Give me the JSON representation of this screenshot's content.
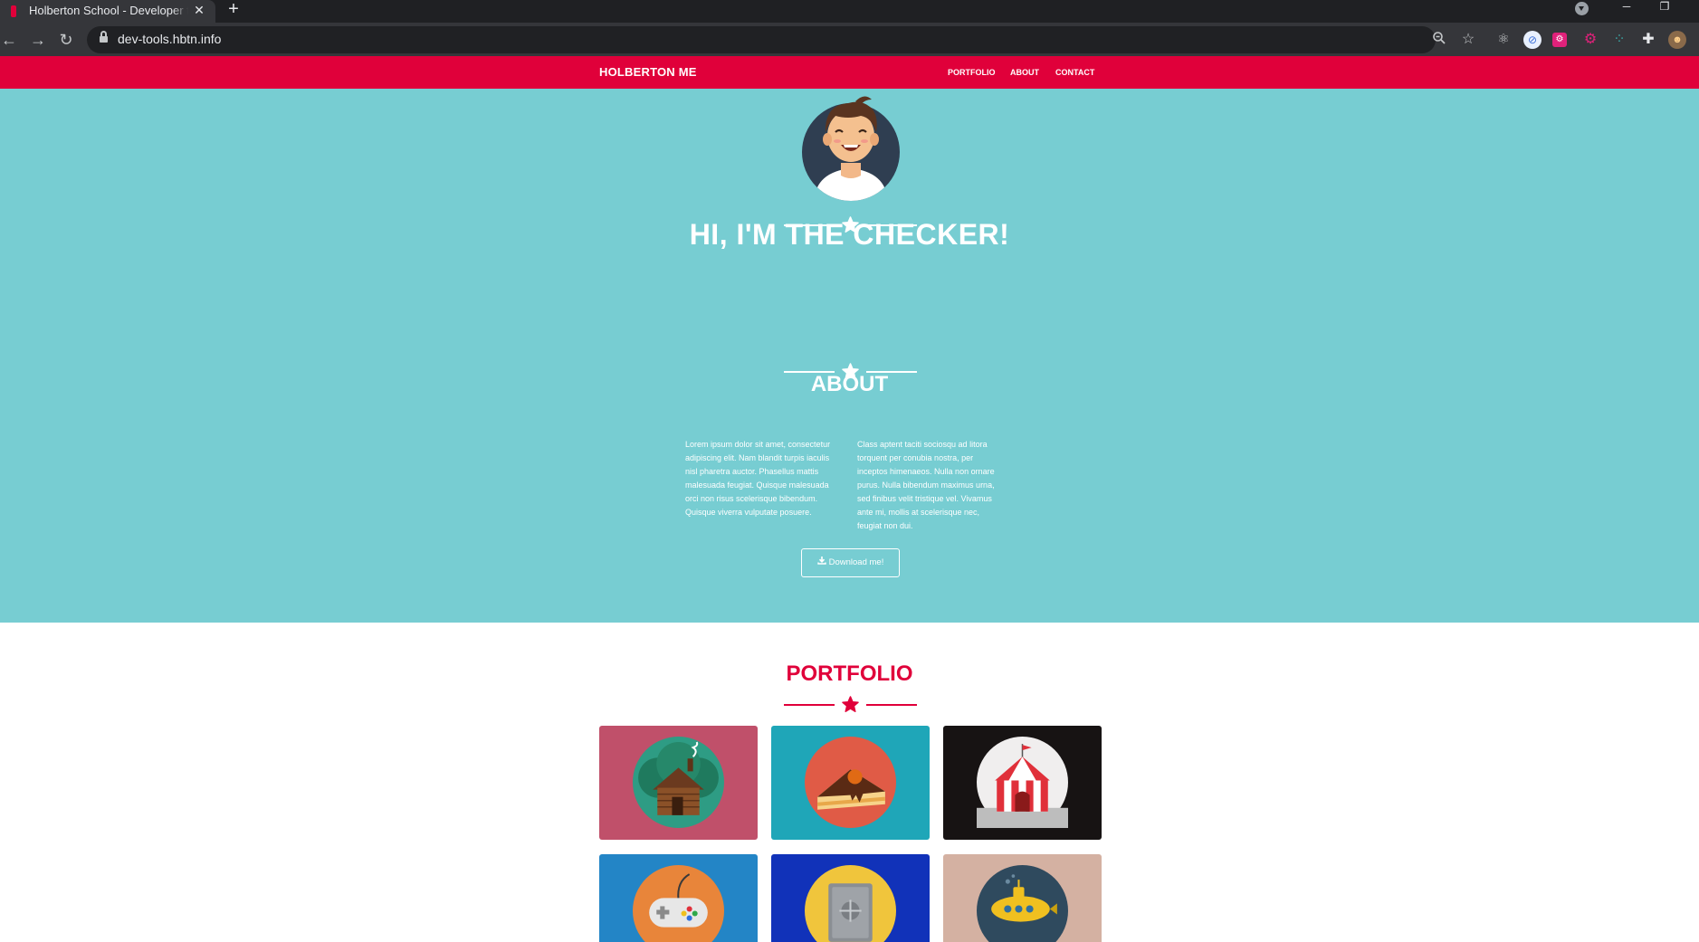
{
  "browser": {
    "tab_title": "Holberton School - Developer to",
    "tab_close": "✕",
    "new_tab": "+",
    "url": "dev-tools.hbtn.info",
    "window_controls": {
      "minimize": "─",
      "restore": "❐"
    },
    "nav_icons": {
      "back": "←",
      "forward": "→",
      "reload": "↻"
    },
    "omnibox_icons": [
      "zoom-icon",
      "bookmark-star-icon"
    ],
    "extension_icons": [
      "react-devtools-icon",
      "extension-blue-icon",
      "extension-pink-icon",
      "extension-magenta-icon",
      "extension-dots-icon",
      "extensions-puzzle-icon",
      "profile-avatar-icon"
    ]
  },
  "navbar": {
    "brand": "HOLBERTON ME",
    "links": [
      "PORTFOLIO",
      "ABOUT",
      "CONTACT"
    ],
    "color": "#e0003a"
  },
  "hero": {
    "title": "HI, I'M THE CHECKER!",
    "background": "#77cdd2"
  },
  "about": {
    "title": "ABOUT",
    "col1": [
      "Lorem ipsum dolor sit amet, consectetur",
      "adipiscing elit. Nam blandit turpis iaculis",
      "nisl pharetra auctor. Phasellus mattis",
      "malesuada feugiat. Quisque malesuada",
      "orci non risus scelerisque bibendum.",
      "Quisque viverra vulputate posuere."
    ],
    "col2": [
      "Class aptent taciti sociosqu ad litora",
      "torquent per conubia nostra, per",
      "inceptos himenaeos. Nulla non ornare",
      "purus. Nulla bibendum maximus urna,",
      "sed finibus velit tristique vel. Vivamus",
      "ante mi, mollis at scelerisque nec,",
      "feugiat non dui."
    ],
    "button_label": "Download me!",
    "button_icon": "download-icon"
  },
  "portfolio": {
    "title": "PORTFOLIO",
    "items": [
      {
        "icon": "cabin-icon",
        "background": "#c0506a"
      },
      {
        "icon": "cake-icon",
        "background": "#1fa6b8"
      },
      {
        "icon": "circus-tent-icon",
        "background": "#171313"
      },
      {
        "icon": "game-controller-icon",
        "background": "#2385c6"
      },
      {
        "icon": "safe-icon",
        "background": "#1132b9"
      },
      {
        "icon": "submarine-icon",
        "background": "#d4b1a2"
      }
    ]
  }
}
